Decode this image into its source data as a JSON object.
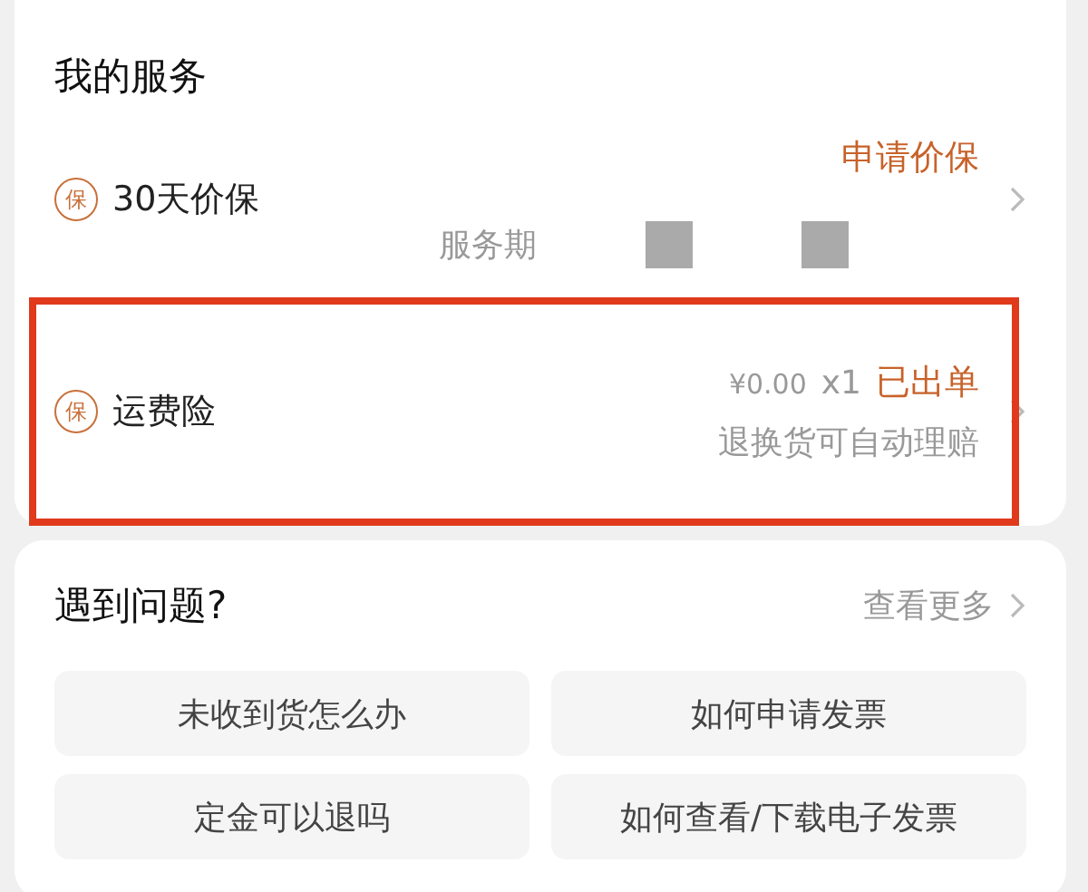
{
  "services": {
    "title": "我的服务",
    "items": [
      {
        "kind": "price",
        "badge": "保",
        "name": "30天价保",
        "action": "申请价保",
        "note": "服务期",
        "redacted": true
      },
      {
        "kind": "shipping",
        "badge": "保",
        "name": "运费险",
        "price": "¥0.00",
        "quantity": "x1",
        "action": "已出单",
        "note": "退换货可自动理赔",
        "highlighted": true
      }
    ]
  },
  "help": {
    "title": "遇到问题?",
    "more": "查看更多",
    "questions": [
      "未收到货怎么办",
      "如何申请发票",
      "定金可以退吗",
      "如何查看/下载电子发票"
    ]
  }
}
